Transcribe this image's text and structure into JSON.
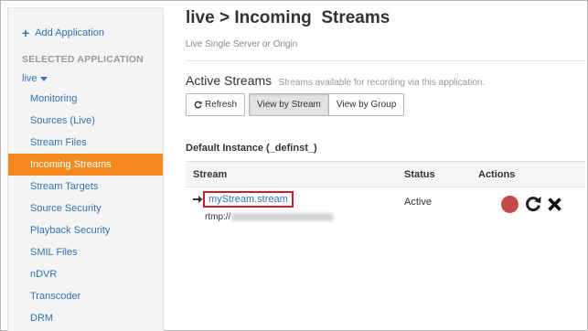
{
  "sidebar": {
    "add_application": "Add Application",
    "selected_header": "SELECTED APPLICATION",
    "app_name": "live",
    "items": [
      {
        "label": "Monitoring",
        "active": false
      },
      {
        "label": "Sources (Live)",
        "active": false
      },
      {
        "label": "Stream Files",
        "active": false
      },
      {
        "label": "Incoming Streams",
        "active": true
      },
      {
        "label": "Stream Targets",
        "active": false
      },
      {
        "label": "Source Security",
        "active": false
      },
      {
        "label": "Playback Security",
        "active": false
      },
      {
        "label": "SMIL Files",
        "active": false
      },
      {
        "label": "nDVR",
        "active": false
      },
      {
        "label": "Transcoder",
        "active": false
      },
      {
        "label": "DRM",
        "active": false
      }
    ]
  },
  "header": {
    "title": "live > Incoming  Streams",
    "subtitle": "Live Single Server or Origin"
  },
  "active_streams": {
    "heading": "Active Streams",
    "description": "Streams available for recording via this application.",
    "buttons": {
      "refresh": "Refresh",
      "view_by_stream": "View by Stream",
      "view_by_group": "View by Group"
    },
    "selected_view": "View by Stream"
  },
  "table": {
    "instance_title": "Default Instance (_definst_)",
    "columns": {
      "stream": "Stream",
      "status": "Status",
      "actions": "Actions"
    },
    "rows": [
      {
        "stream_name": "myStream.stream",
        "source_prefix": "rtmp://",
        "status": "Active"
      }
    ]
  },
  "colors": {
    "accent": "#f58a1f",
    "link": "#2f74b5",
    "highlight_border": "#cc1f2b",
    "record_button": "#c44a4a"
  },
  "icons": {
    "add": "plus-icon",
    "refresh": "refresh-icon",
    "row_marker": "arrow-right-icon",
    "record": "record-icon",
    "reset": "reset-icon",
    "remove": "close-icon"
  }
}
